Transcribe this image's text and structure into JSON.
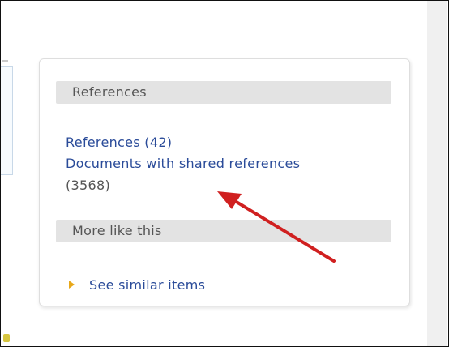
{
  "panel": {
    "references_header": "References",
    "references_link": "References (42)",
    "shared_refs_link": "Documents with shared references",
    "shared_refs_count": "(3568)",
    "more_like_this_header": "More like this",
    "similar_items_link": "See similar items"
  },
  "colors": {
    "link": "#2a4b99",
    "annotation_arrow": "#d02020",
    "bullet": "#e8a81a"
  }
}
